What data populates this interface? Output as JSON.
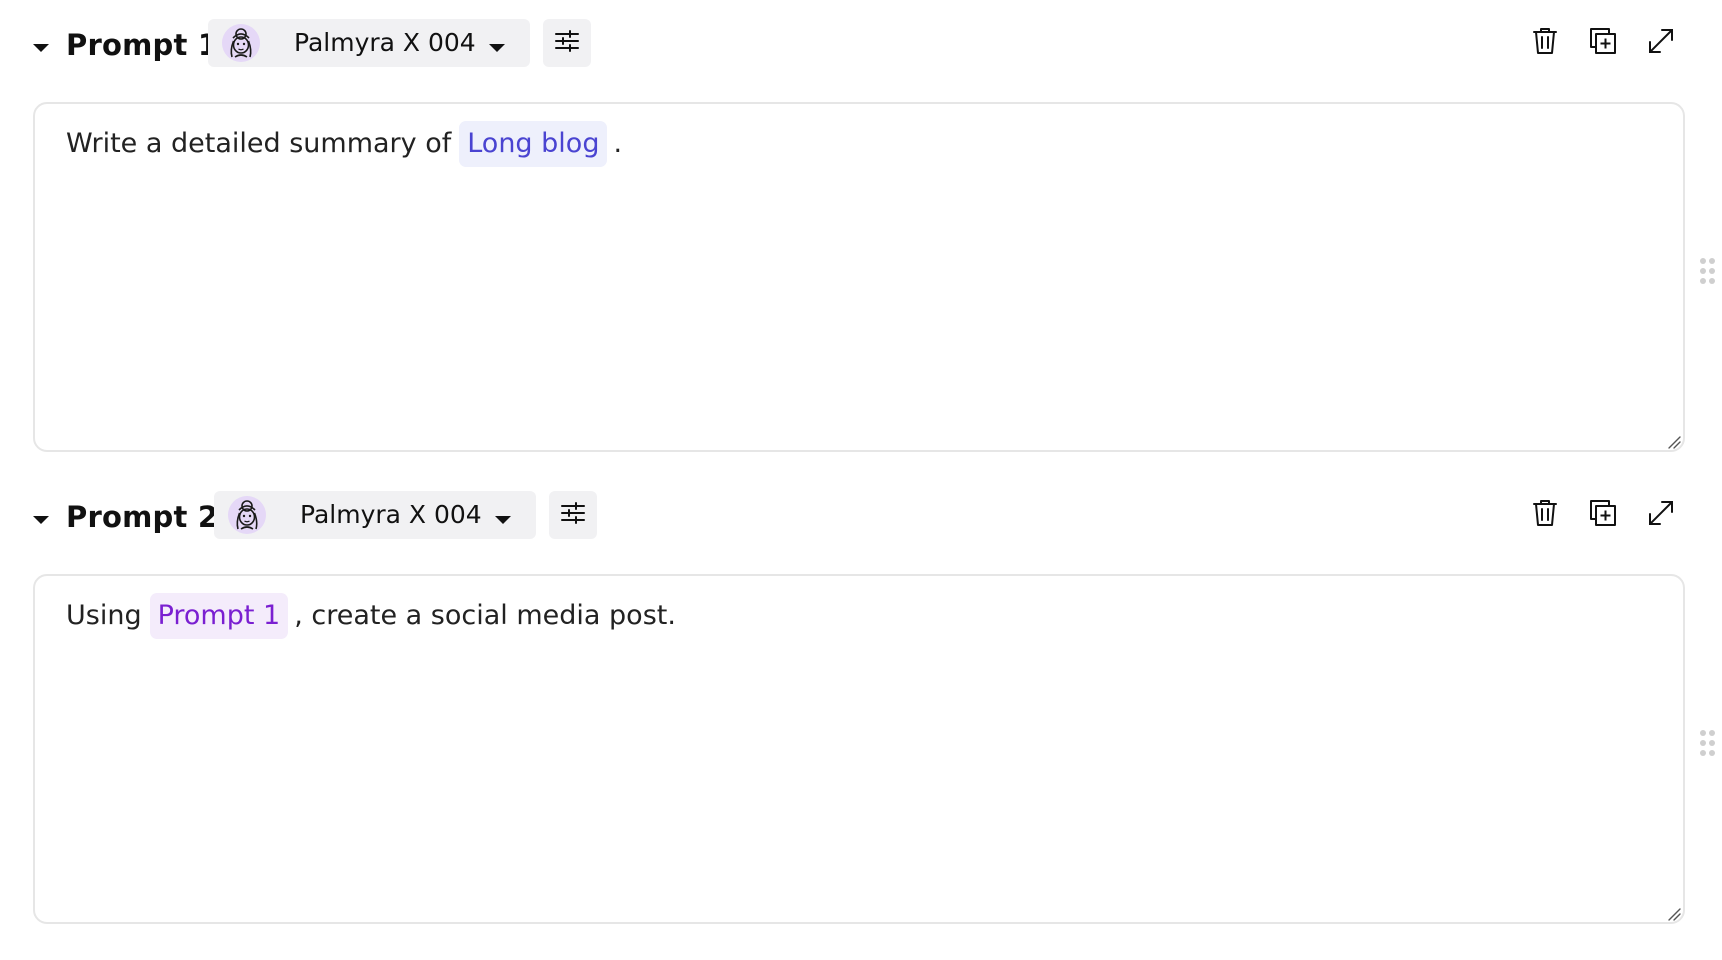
{
  "prompts": [
    {
      "title": "Prompt 1",
      "model": "Palmyra X 004",
      "text_before": "Write a detailed summary of",
      "chip": "Long blog",
      "chip_color": "#4a44d1",
      "text_after": "."
    },
    {
      "title": "Prompt 2",
      "model": "Palmyra X 004",
      "text_before": "Using",
      "chip": "Prompt 1",
      "chip_color": "#7a1fd1",
      "text_after": ", create a social media post."
    }
  ],
  "icons": {
    "collapse": "caret-down-icon",
    "avatar": "model-avatar-icon",
    "model_dropdown": "chevron-down-icon",
    "settings": "sliders-icon",
    "delete": "trash-icon",
    "duplicate": "duplicate-icon",
    "expand": "expand-icon",
    "resize": "resize-grip-icon",
    "drag": "drag-handle-icon"
  },
  "colors": {
    "chip_blue_bg": "#eef0fc",
    "chip_purple_bg": "#f4ecfb",
    "control_bg": "#f1f1f3",
    "editor_border": "#e6e6e6"
  }
}
